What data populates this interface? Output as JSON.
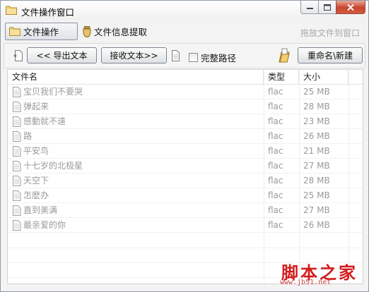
{
  "window": {
    "title": "文件操作窗口",
    "controls": {
      "minimize": "minimize",
      "maximize": "maximize",
      "close": "close"
    }
  },
  "tabs": [
    {
      "label": "文件操作",
      "active": true,
      "icon": "folder-icon"
    },
    {
      "label": "文件信息提取",
      "active": false,
      "icon": "jar-icon"
    }
  ],
  "drag_hint": "拖放文件到窗口",
  "toolbar": {
    "export_label": "<< 导出文本",
    "receive_label": "接收文本>>",
    "full_path_label": "完整路径",
    "full_path_checked": false,
    "rename_label": "重命名\\新建"
  },
  "list": {
    "columns": {
      "name": "文件名",
      "type": "类型",
      "size": "大小"
    },
    "rows": [
      {
        "name": "宝贝我们不要哭",
        "type": "flac",
        "size": "25 MB"
      },
      {
        "name": "弹起来",
        "type": "flac",
        "size": "28 MB"
      },
      {
        "name": "感動就不遠",
        "type": "flac",
        "size": "23 MB"
      },
      {
        "name": "路",
        "type": "flac",
        "size": "26 MB"
      },
      {
        "name": "平安鸟",
        "type": "flac",
        "size": "21 MB"
      },
      {
        "name": "十七岁的北极星",
        "type": "flac",
        "size": "27 MB"
      },
      {
        "name": "天空下",
        "type": "flac",
        "size": "28 MB"
      },
      {
        "name": "怎麽办",
        "type": "flac",
        "size": "25 MB"
      },
      {
        "name": "直到美满",
        "type": "flac",
        "size": "27 MB"
      },
      {
        "name": "最亲爱的你",
        "type": "flac",
        "size": "26 MB"
      }
    ]
  },
  "watermark": {
    "title": "脚本之家",
    "url": "www.jb51.net"
  },
  "colors": {
    "accent_close": "#c7432d",
    "muted_text": "#9a9a9a",
    "folder": "#e8c15a",
    "watermark": "#d21c1c"
  }
}
